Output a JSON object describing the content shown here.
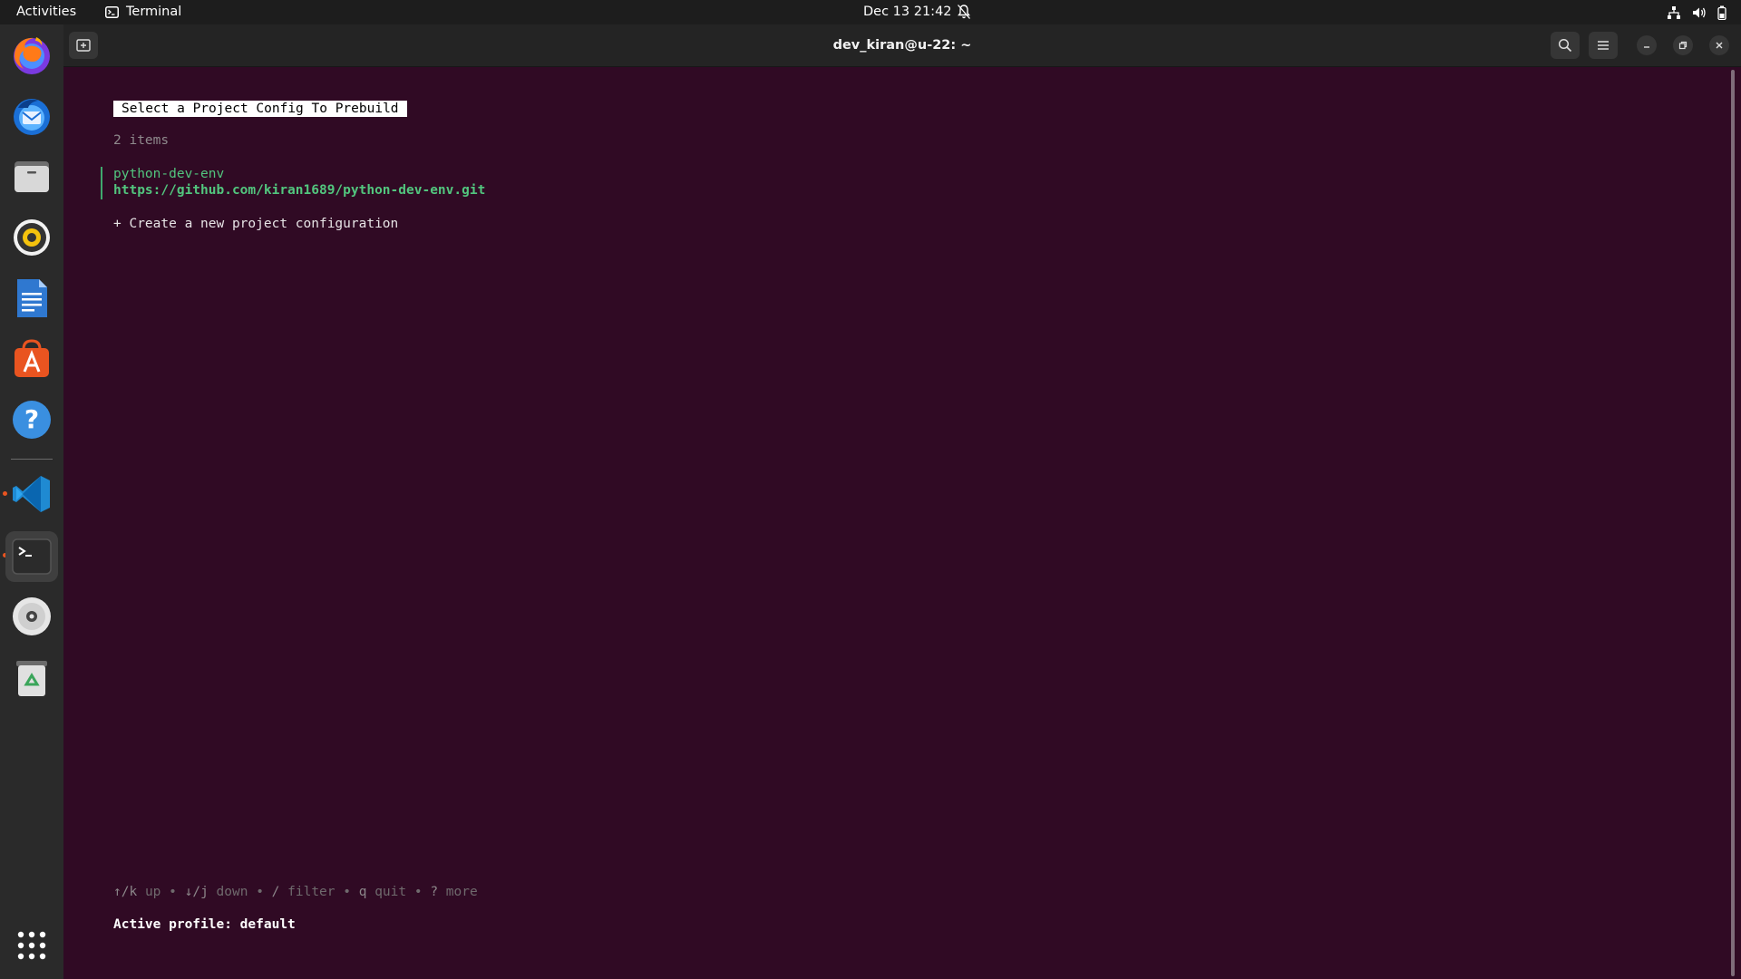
{
  "topbar": {
    "activities": "Activities",
    "app_name": "Terminal",
    "clock": "Dec 13  21:42"
  },
  "dock": {
    "items": [
      {
        "name": "firefox",
        "icon": "firefox-icon"
      },
      {
        "name": "thunderbird",
        "icon": "thunderbird-icon"
      },
      {
        "name": "files",
        "icon": "files-icon"
      },
      {
        "name": "rhythmbox",
        "icon": "rhythmbox-icon"
      },
      {
        "name": "libreoffice-writer",
        "icon": "writer-icon"
      },
      {
        "name": "app-center",
        "icon": "app-center-icon"
      },
      {
        "name": "help",
        "icon": "help-icon"
      },
      {
        "name": "vscode",
        "icon": "vscode-icon",
        "running": true
      },
      {
        "name": "terminal",
        "icon": "terminal-icon",
        "running": true,
        "active": true
      },
      {
        "name": "disc",
        "icon": "disc-icon"
      },
      {
        "name": "trash",
        "icon": "trash-icon"
      },
      {
        "name": "show-apps",
        "icon": "grid-icon"
      }
    ]
  },
  "window": {
    "title": "dev_kiran@u-22: ~"
  },
  "terminal": {
    "prompt_title": "Select a Project Config To Prebuild",
    "item_count": "2 items",
    "items": [
      {
        "name": "python-dev-env",
        "url": "https://github.com/kiran1689/python-dev-env.git",
        "selected": true
      },
      {
        "label": "+ Create a new project configuration"
      }
    ],
    "help": {
      "up_key": "↑/k",
      "up": "up",
      "down_key": "↓/j",
      "down": "down",
      "filter_key": "/",
      "filter": "filter",
      "quit_key": "q",
      "quit": "quit",
      "more_key": "?",
      "more": "more",
      "sep": "•"
    },
    "profile_line": "Active profile: default"
  },
  "colors": {
    "terminal_bg": "#300a24",
    "accent_green": "#52c67e",
    "ubuntu_orange": "#e95420"
  }
}
